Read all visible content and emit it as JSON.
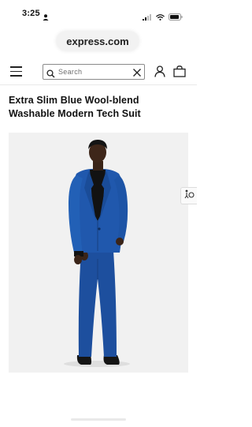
{
  "status_bar": {
    "time": "3:25"
  },
  "browser": {
    "url": "express.com"
  },
  "header": {
    "search_placeholder": "Search"
  },
  "product": {
    "title_line1": "Extra Slim Blue Wool-blend",
    "title_line2": "Washable Modern Tech Suit"
  },
  "colors": {
    "suit": "#1f56a8",
    "shirt": "#111111",
    "image_background": "#f1f1f1"
  },
  "icons": {
    "menu": "hamburger-menu-icon",
    "search": "search-icon",
    "clear": "close-icon",
    "account": "user-icon",
    "bag": "shopping-bag-icon",
    "side_tab": "accessibility-icon"
  }
}
